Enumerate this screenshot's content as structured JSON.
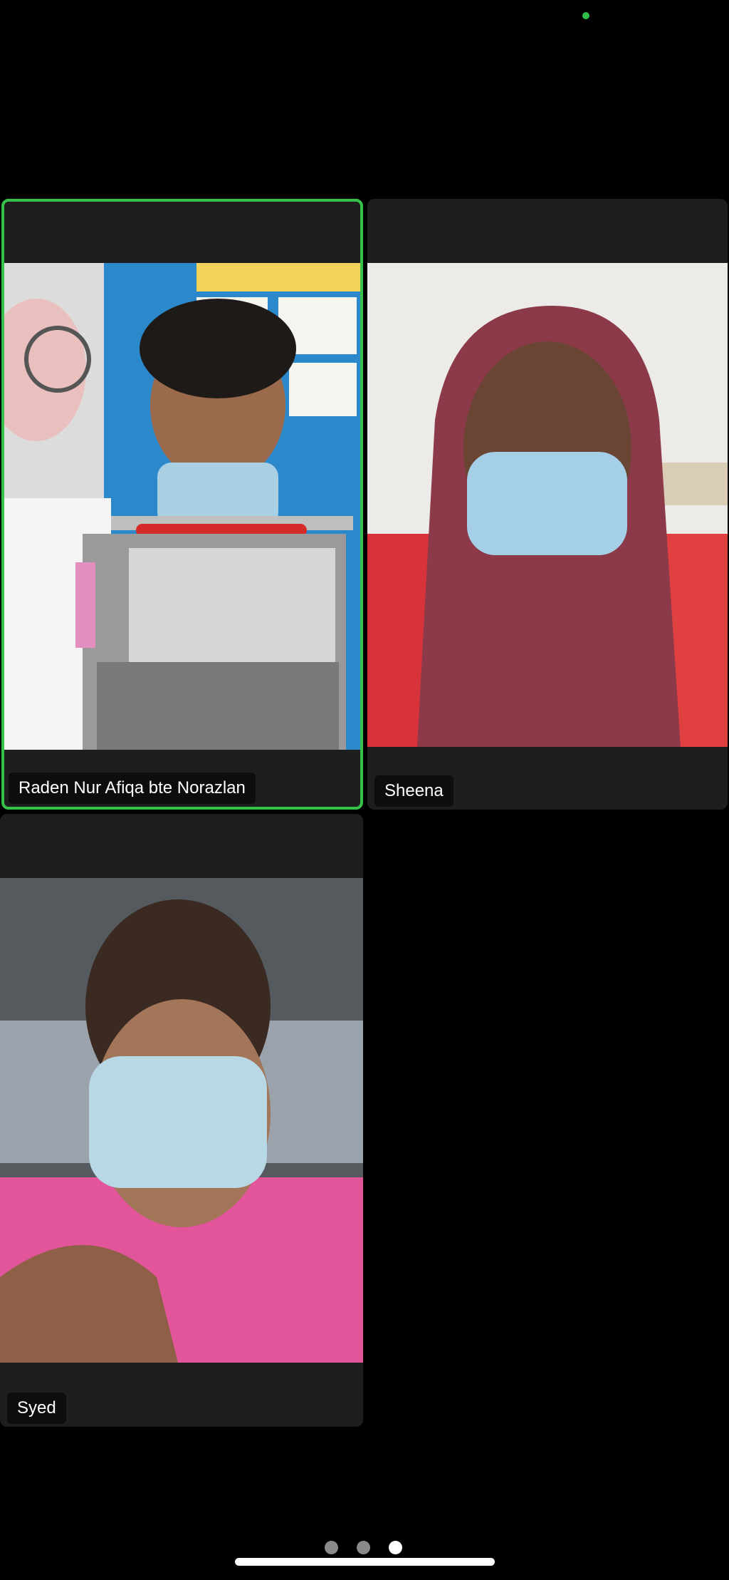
{
  "status": {
    "indicator_color": "#2fbf4a"
  },
  "participants": [
    {
      "name": "Raden Nur Afiqa bte Norazlan",
      "active_speaker": true
    },
    {
      "name": "Sheena",
      "active_speaker": false
    },
    {
      "name": "Syed",
      "active_speaker": false
    }
  ],
  "pagination": {
    "total_pages": 3,
    "current_page": 3
  },
  "colors": {
    "active_border": "#36c24a",
    "tile_bg": "#1e1e1e"
  }
}
